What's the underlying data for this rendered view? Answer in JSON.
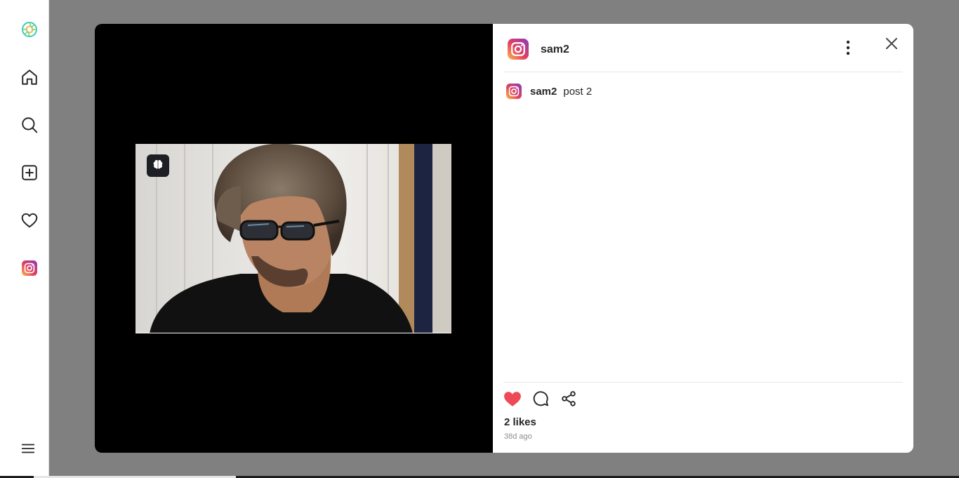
{
  "sidebar": {
    "items": [
      {
        "icon": "app-logo-icon"
      },
      {
        "icon": "home-icon"
      },
      {
        "icon": "search-icon"
      },
      {
        "icon": "create-icon"
      },
      {
        "icon": "heart-icon"
      },
      {
        "icon": "profile-avatar-icon"
      },
      {
        "icon": "menu-icon"
      }
    ]
  },
  "post": {
    "username": "sam2",
    "caption_user": "sam2",
    "caption_text": "post 2",
    "likes": "2 likes",
    "time": "38d ago",
    "liked": true
  },
  "colors": {
    "like": "#ed4956",
    "backdrop": "#808080",
    "media_bg": "#000000",
    "ai_badge": "#1e1f24"
  }
}
